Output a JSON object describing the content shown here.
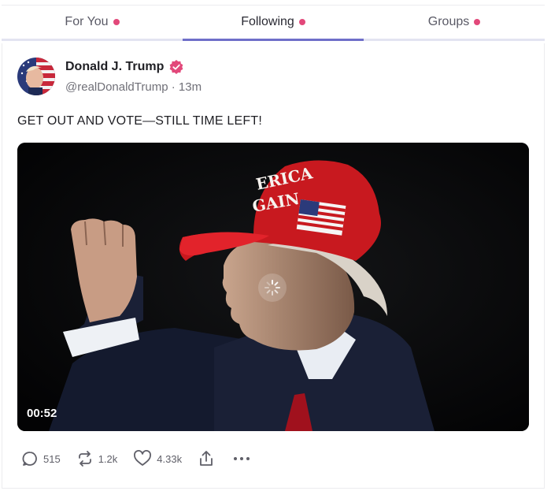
{
  "tabs": [
    {
      "label": "For You",
      "active": false
    },
    {
      "label": "Following",
      "active": true
    },
    {
      "label": "Groups",
      "active": false
    }
  ],
  "colors": {
    "accent": "#6f6fc9",
    "badge": "#e2487a",
    "verified": "#e2487a"
  },
  "post": {
    "author_name": "Donald J. Trump",
    "handle": "@realDonaldTrump",
    "time_sep": " · ",
    "time": "13m",
    "text": "GET OUT AND VOTE—STILL TIME LEFT!",
    "video_duration": "00:52",
    "hat_text_1": "ERICA",
    "hat_text_2": "GAIN"
  },
  "actions": {
    "replies": "515",
    "reposts": "1.2k",
    "likes": "4.33k",
    "share_icon": "share-icon",
    "more_icon": "more-icon"
  }
}
